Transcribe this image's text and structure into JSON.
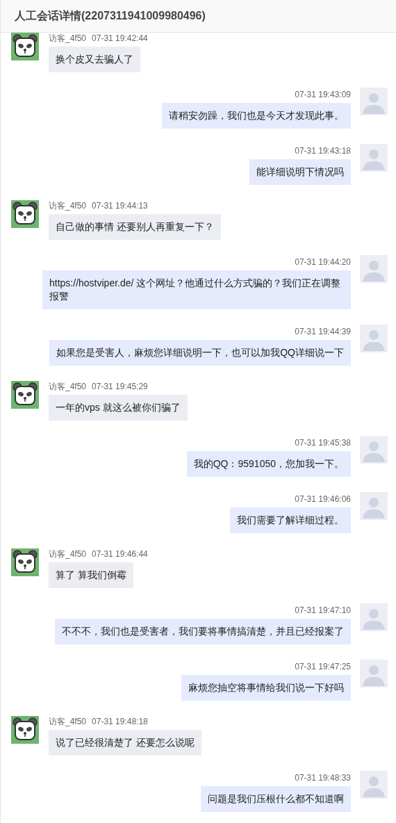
{
  "title": "人工会话详情(2207311941009980496)",
  "messages": [
    {
      "kind": "visitor",
      "name": "访客_4f50",
      "time": "07-31 19:42:44",
      "text": "换个皮又去骗人了"
    },
    {
      "kind": "agent",
      "time": "07-31 19:43:09",
      "text": "请稍安勿躁，我们也是今天才发现此事。"
    },
    {
      "kind": "agent",
      "time": "07-31 19:43:18",
      "text": "能详细说明下情况吗"
    },
    {
      "kind": "visitor",
      "name": "访客_4f50",
      "time": "07-31 19:44:13",
      "text": "自己做的事情 还要别人再重复一下？"
    },
    {
      "kind": "agent",
      "time": "07-31 19:44:20",
      "text": "https://hostviper.de/ 这个网址？他通过什么方式骗的？我们正在调整报警"
    },
    {
      "kind": "agent",
      "time": "07-31 19:44:39",
      "text": "如果您是受害人，麻烦您详细说明一下，也可以加我QQ详细说一下"
    },
    {
      "kind": "visitor",
      "name": "访客_4f50",
      "time": "07-31 19:45:29",
      "text": "一年的vps 就这么被你们骗了"
    },
    {
      "kind": "agent",
      "time": "07-31 19:45:38",
      "text": "我的QQ：9591050，您加我一下。"
    },
    {
      "kind": "agent",
      "time": "07-31 19:46:06",
      "text": "我们需要了解详细过程。"
    },
    {
      "kind": "visitor",
      "name": "访客_4f50",
      "time": "07-31 19:46:44",
      "text": "算了 算我们倒霉"
    },
    {
      "kind": "agent",
      "time": "07-31 19:47:10",
      "text": "不不不，我们也是受害者，我们要将事情搞清楚，并且已经报案了"
    },
    {
      "kind": "agent",
      "time": "07-31 19:47:25",
      "text": "麻烦您抽空将事情给我们说一下好吗"
    },
    {
      "kind": "visitor",
      "name": "访客_4f50",
      "time": "07-31 19:48:18",
      "text": "说了已经很清楚了 还要怎么说呢"
    },
    {
      "kind": "agent",
      "time": "07-31 19:48:33",
      "text": "问题是我们压根什么都不知道啊"
    }
  ]
}
